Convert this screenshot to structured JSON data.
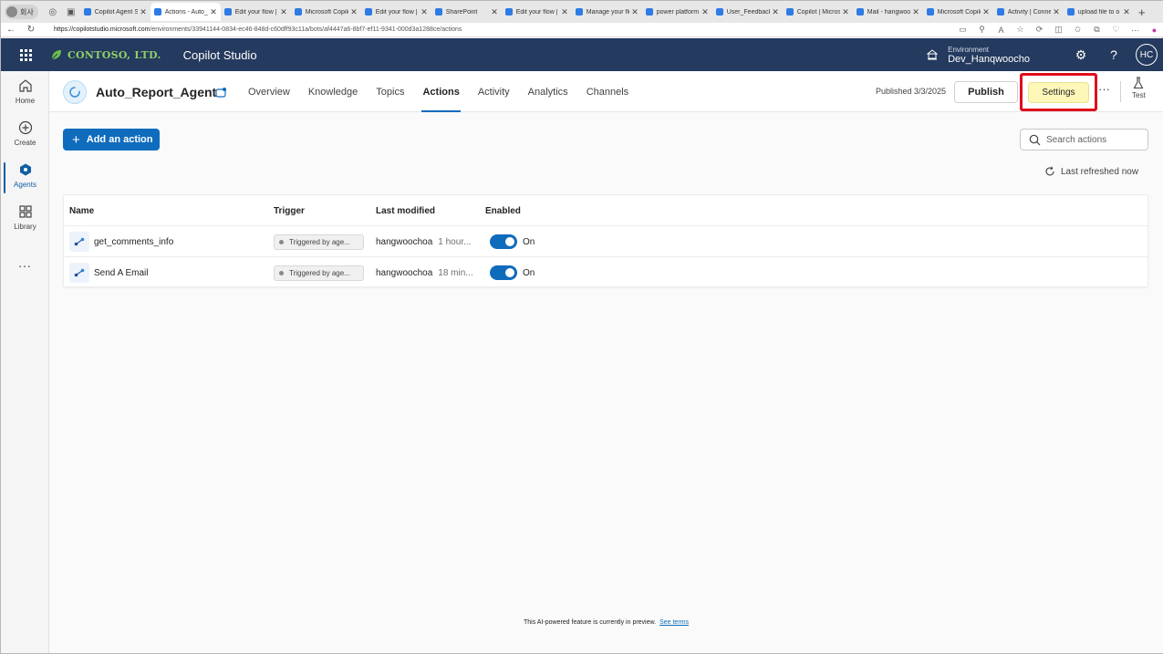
{
  "browser": {
    "profile_label": "회사",
    "tabs": [
      {
        "title": "Copilot Agent Sh",
        "active": false
      },
      {
        "title": "Actions - Auto_",
        "active": true
      },
      {
        "title": "Edit your flow | F",
        "active": false
      },
      {
        "title": "Microsoft Copilo",
        "active": false
      },
      {
        "title": "Edit your flow | F",
        "active": false
      },
      {
        "title": "SharePoint",
        "active": false
      },
      {
        "title": "Edit your flow | F",
        "active": false
      },
      {
        "title": "Manage your flo",
        "active": false
      },
      {
        "title": "power platform",
        "active": false
      },
      {
        "title": "User_Feedback",
        "active": false
      },
      {
        "title": "Copilot | Micros",
        "active": false
      },
      {
        "title": "Mail - hangwoo",
        "active": false
      },
      {
        "title": "Microsoft Copilo",
        "active": false
      },
      {
        "title": "Activity | Conne",
        "active": false
      },
      {
        "title": "upload file to o",
        "active": false
      }
    ],
    "url_host": "https://copilotstudio.microsoft.com",
    "url_path": "/environments/33941144-0834-ec46-848d-c60dff93c11a/bots/af4447a6-8bf7-ef11-9341-000d3a1288ce/actions"
  },
  "header": {
    "company": "CONTOSO, LTD.",
    "product": "Copilot Studio",
    "environment_label": "Environment",
    "environment_name": "Dev_Hanqwoocho",
    "avatar_initials": "HC"
  },
  "rail": {
    "items": [
      {
        "label": "Home",
        "icon": "home-icon"
      },
      {
        "label": "Create",
        "icon": "plus-circle-icon"
      },
      {
        "label": "Agents",
        "icon": "agents-icon",
        "active": true
      },
      {
        "label": "Library",
        "icon": "library-icon"
      }
    ],
    "more": "..."
  },
  "agent": {
    "name": "Auto_Report_Agent",
    "tabs": [
      "Overview",
      "Knowledge",
      "Topics",
      "Actions",
      "Activity",
      "Analytics",
      "Channels"
    ],
    "active_tab": "Actions",
    "published": "Published 3/3/2025",
    "publish_label": "Publish",
    "settings_label": "Settings",
    "more": "···",
    "test_label": "Test"
  },
  "toolbar": {
    "add_action_label": "Add an action",
    "search_placeholder": "Search actions",
    "refresh_text": "Last refreshed now"
  },
  "table": {
    "columns": [
      "Name",
      "Trigger",
      "Last modified",
      "Enabled"
    ],
    "rows": [
      {
        "name": "get_comments_info",
        "trigger": "Triggered by age...",
        "modified_by": "hangwoochoa",
        "modified_time": "1 hour...",
        "enabled": "On"
      },
      {
        "name": "Send A Email",
        "trigger": "Triggered by age...",
        "modified_by": "hangwoochoa",
        "modified_time": "18 min...",
        "enabled": "On"
      }
    ]
  },
  "footer": {
    "text": "This AI-powered feature is currently in preview.",
    "link": "See terms"
  },
  "colors": {
    "header_bg": "#243a5e",
    "accent": "#0f6cbd",
    "highlight_box": "#e00b1c",
    "settings_bg": "#fdf7b8"
  }
}
